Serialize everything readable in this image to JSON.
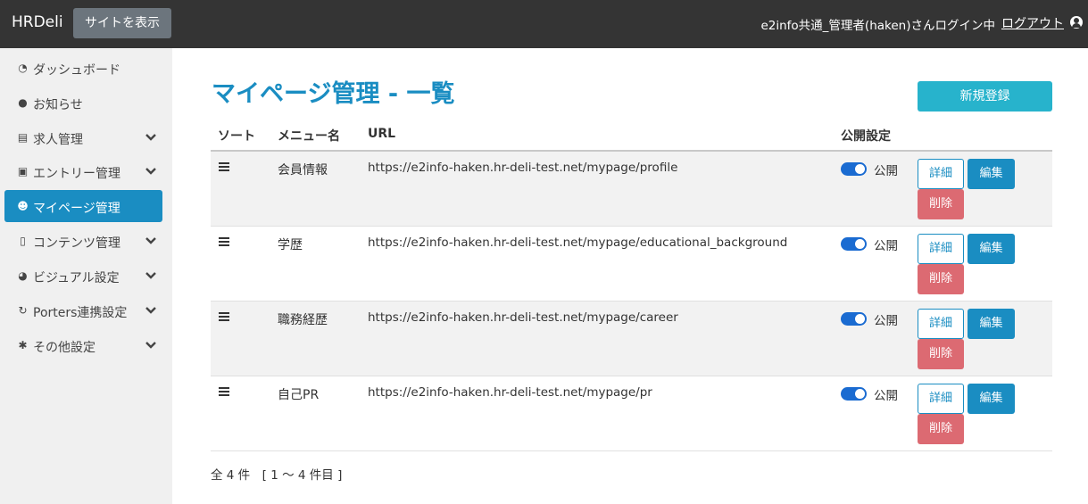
{
  "topbar": {
    "brand": "HRDeli",
    "site_button": "サイトを表示",
    "login_info": "e2info共通_管理者(haken)さんログイン中",
    "logout": "ログアウト"
  },
  "sidebar": {
    "items": [
      {
        "label": "ダッシュボード",
        "icon": "dashboard-icon",
        "has_chevron": false,
        "active": false
      },
      {
        "label": "お知らせ",
        "icon": "info-icon",
        "has_chevron": false,
        "active": false
      },
      {
        "label": "求人管理",
        "icon": "list-card-icon",
        "has_chevron": true,
        "active": false
      },
      {
        "label": "エントリー管理",
        "icon": "id-card-icon",
        "has_chevron": true,
        "active": false
      },
      {
        "label": "マイページ管理",
        "icon": "user-gear-icon",
        "has_chevron": false,
        "active": true
      },
      {
        "label": "コンテンツ管理",
        "icon": "document-icon",
        "has_chevron": true,
        "active": false
      },
      {
        "label": "ビジュアル設定",
        "icon": "palette-icon",
        "has_chevron": true,
        "active": false
      },
      {
        "label": "Porters連携設定",
        "icon": "sync-icon",
        "has_chevron": true,
        "active": false
      },
      {
        "label": "その他設定",
        "icon": "gear-icon",
        "has_chevron": true,
        "active": false
      }
    ]
  },
  "main": {
    "title": "マイページ管理 - 一覧",
    "new_button": "新規登録",
    "columns": {
      "sort": "ソート",
      "menu": "メニュー名",
      "url": "URL",
      "publish": "公開設定"
    },
    "rows": [
      {
        "name": "会員情報",
        "url": "https://e2info-haken.hr-deli-test.net/mypage/profile",
        "status": "公開"
      },
      {
        "name": "学歴",
        "url": "https://e2info-haken.hr-deli-test.net/mypage/educational_background",
        "status": "公開"
      },
      {
        "name": "職務経歴",
        "url": "https://e2info-haken.hr-deli-test.net/mypage/career",
        "status": "公開"
      },
      {
        "name": "自己PR",
        "url": "https://e2info-haken.hr-deli-test.net/mypage/pr",
        "status": "公開"
      }
    ],
    "actions": {
      "detail": "詳細",
      "edit": "編集",
      "delete": "削除"
    },
    "count_text": "全 4 件　[ 1 ～ 4 件目 ]"
  },
  "colors": {
    "topbar": "#343434",
    "accent": "#1a8dc2",
    "new_button": "#27b3cc",
    "delete": "#dc6a72",
    "toggle": "#1a6bd1"
  }
}
